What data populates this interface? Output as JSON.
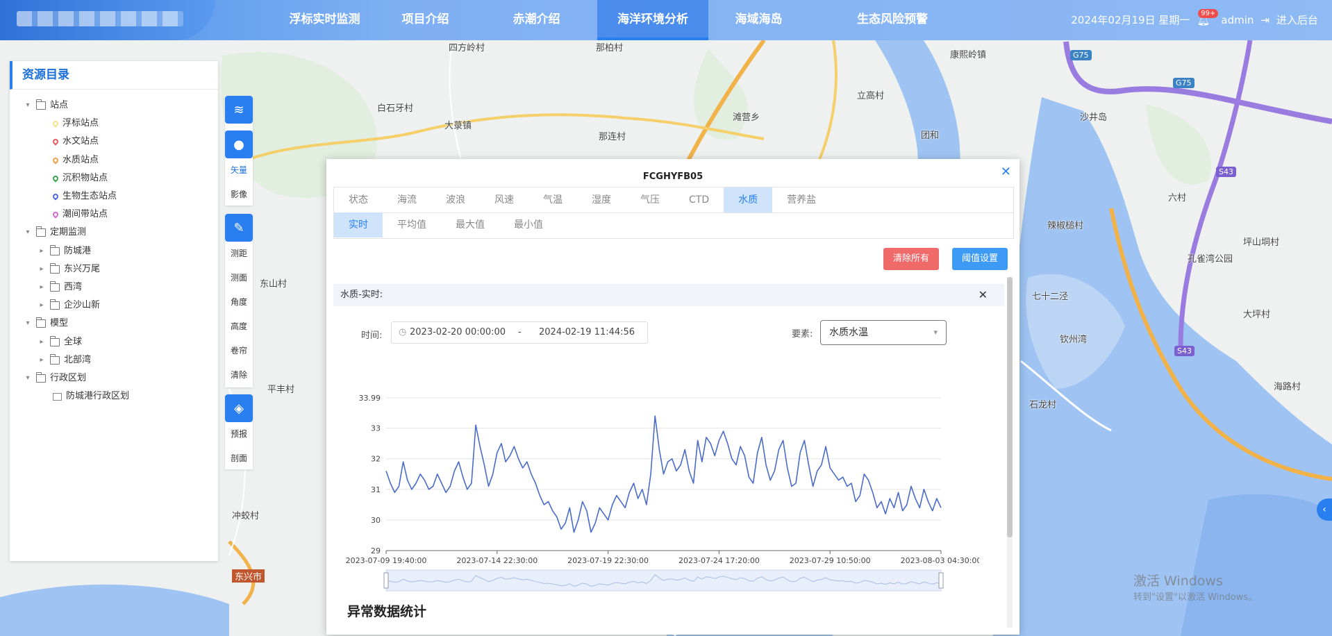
{
  "header": {
    "nav": [
      {
        "label": "浮标实时监测",
        "active": false
      },
      {
        "label": "项目介绍",
        "active": false
      },
      {
        "label": "赤潮介绍",
        "active": false
      },
      {
        "label": "海洋环境分析",
        "active": true
      },
      {
        "label": "海域海岛",
        "active": false
      },
      {
        "label": "生态风险预警",
        "active": false
      }
    ],
    "date": "2024年02月19日 星期一",
    "notification_count": "99+",
    "user": "admin",
    "admin_link": "进入后台"
  },
  "map_labels": [
    "四方岭村",
    "那柏村",
    "康熙岭镇",
    "白石牙村",
    "立高村",
    "大菉镇",
    "滩营乡",
    "那连村",
    "团和",
    "沙井岛",
    "六村",
    "辣椒槌村",
    "孔雀湾公园",
    "坪山垌村",
    "东山村",
    "七十二泾",
    "钦州湾",
    "大坪村",
    "平丰村",
    "石龙村",
    "海路村",
    "冲蛟村",
    "东兴市"
  ],
  "road_shields": [
    "G75",
    "G75",
    "S43",
    "S43"
  ],
  "resources": {
    "title": "资源目录",
    "tree": [
      {
        "level": 0,
        "label": "站点",
        "type": "folder",
        "expanded": true
      },
      {
        "level": 1,
        "label": "浮标站点",
        "type": "pin",
        "color": "#f3e48a"
      },
      {
        "level": 1,
        "label": "水文站点",
        "type": "pin",
        "color": "#e85a5a"
      },
      {
        "level": 1,
        "label": "水质站点",
        "type": "pin",
        "color": "#f2a04b"
      },
      {
        "level": 1,
        "label": "沉积物站点",
        "type": "pin",
        "color": "#3aa64a"
      },
      {
        "level": 1,
        "label": "生物生态站点",
        "type": "pin",
        "color": "#4a6ce0"
      },
      {
        "level": 1,
        "label": "潮间带站点",
        "type": "pin",
        "color": "#d66ad6"
      },
      {
        "level": 0,
        "label": "定期监测",
        "type": "folder",
        "expanded": true
      },
      {
        "level": 1,
        "label": "防城港",
        "type": "folder",
        "expanded": false
      },
      {
        "level": 1,
        "label": "东兴万尾",
        "type": "folder",
        "expanded": false
      },
      {
        "level": 1,
        "label": "西湾",
        "type": "folder",
        "expanded": false
      },
      {
        "level": 1,
        "label": "企沙山新",
        "type": "folder",
        "expanded": false
      },
      {
        "level": 0,
        "label": "模型",
        "type": "folder",
        "expanded": true
      },
      {
        "level": 1,
        "label": "全球",
        "type": "folder",
        "expanded": false
      },
      {
        "level": 1,
        "label": "北部湾",
        "type": "folder",
        "expanded": false
      },
      {
        "level": 0,
        "label": "行政区划",
        "type": "folder",
        "expanded": true
      },
      {
        "level": 1,
        "label": "防城港行政区划",
        "type": "layer"
      }
    ]
  },
  "toolbar": {
    "basemap_options": [
      "矢量",
      "影像"
    ],
    "selected_basemap": "矢量",
    "tools": [
      "测距",
      "测面",
      "角度",
      "高度",
      "卷帘",
      "清除"
    ],
    "analysis": [
      "预报",
      "剖面"
    ]
  },
  "popup": {
    "title": "FCGHYFB05",
    "tabs": [
      "状态",
      "海流",
      "波浪",
      "风速",
      "气温",
      "湿度",
      "气压",
      "CTD",
      "水质",
      "营养盐"
    ],
    "active_tab": "水质",
    "sub_tabs": [
      "实时",
      "平均值",
      "最大值",
      "最小值"
    ],
    "active_sub_tab": "实时",
    "clear_button": "清除所有",
    "threshold_button": "阈值设置",
    "section_title": "水质-实时:",
    "time_label": "时间:",
    "time_start": "2023-02-20 00:00:00",
    "time_sep": "-",
    "time_end": "2024-02-19 11:44:56",
    "element_label": "要素:",
    "element_value": "水质水温",
    "anomaly_title": "异常数据统计"
  },
  "chart_data": {
    "type": "line",
    "x_tick_labels": [
      "2023-07-09 19:40:00",
      "2023-07-14 22:30:00",
      "2023-07-19 22:30:00",
      "2023-07-24 17:20:00",
      "2023-07-29 10:50:00",
      "2023-08-03 04:30:00"
    ],
    "y_tick_labels": [
      "29",
      "30",
      "31",
      "32",
      "33",
      "33.99"
    ],
    "ylim": [
      29,
      33.99
    ],
    "grid": true,
    "color": "#4a6bc6",
    "series": [
      {
        "values": [
          31.6,
          31.2,
          30.9,
          31.1,
          31.9,
          31.3,
          31.0,
          31.2,
          31.5,
          31.3,
          31.0,
          31.1,
          31.5,
          31.2,
          30.9,
          31.1,
          31.6,
          31.9,
          31.4,
          31.0,
          31.2,
          33.1,
          32.4,
          31.8,
          31.1,
          31.5,
          32.2,
          32.5,
          31.9,
          32.1,
          32.4,
          32.0,
          31.7,
          31.9,
          31.5,
          31.2,
          30.8,
          30.5,
          30.6,
          30.3,
          30.1,
          29.7,
          29.9,
          30.4,
          29.6,
          30.0,
          30.6,
          30.3,
          29.6,
          29.9,
          30.4,
          30.2,
          30.0,
          30.5,
          30.8,
          30.6,
          30.4,
          30.9,
          31.2,
          30.7,
          31.0,
          30.5,
          31.5,
          33.4,
          32.3,
          31.5,
          31.9,
          32.0,
          31.6,
          31.8,
          32.3,
          31.6,
          31.2,
          32.6,
          31.9,
          32.7,
          32.5,
          32.1,
          32.6,
          32.9,
          32.5,
          32.0,
          31.8,
          32.4,
          32.1,
          31.4,
          31.2,
          32.2,
          32.7,
          31.8,
          31.3,
          31.6,
          32.3,
          32.6,
          31.7,
          31.1,
          31.2,
          32.2,
          32.6,
          31.8,
          31.1,
          31.6,
          31.8,
          32.4,
          31.7,
          31.5,
          31.3,
          31.4,
          31.1,
          31.2,
          30.6,
          30.8,
          31.5,
          31.3,
          30.9,
          30.4,
          30.6,
          30.2,
          30.7,
          30.4,
          30.9,
          30.3,
          30.5,
          31.1,
          30.7,
          30.4,
          31.0,
          30.6,
          30.3,
          30.7,
          30.4
        ]
      }
    ]
  }
}
